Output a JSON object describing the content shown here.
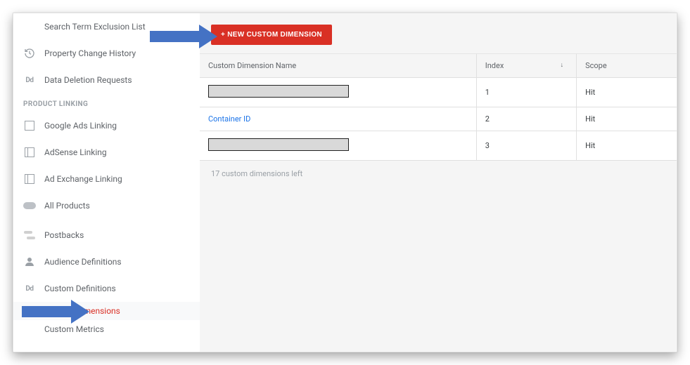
{
  "sidebar": {
    "items_top": [
      {
        "label": "Search Term Exclusion List",
        "icon": "blank"
      },
      {
        "label": "Property Change History",
        "icon": "history"
      },
      {
        "label": "Data Deletion Requests",
        "icon": "dd"
      }
    ],
    "section_label": "PRODUCT LINKING",
    "items_linking": [
      {
        "label": "Google Ads Linking",
        "icon": "square"
      },
      {
        "label": "AdSense Linking",
        "icon": "square-split"
      },
      {
        "label": "Ad Exchange Linking",
        "icon": "square-split"
      },
      {
        "label": "All Products",
        "icon": "pill"
      }
    ],
    "items_bottom": [
      {
        "label": "Postbacks",
        "icon": "arrows"
      },
      {
        "label": "Audience Definitions",
        "icon": "person"
      },
      {
        "label": "Custom Definitions",
        "icon": "dd"
      }
    ],
    "subitems": [
      {
        "label": "Custom Dimensions",
        "active": true
      },
      {
        "label": "Custom Metrics",
        "active": false
      }
    ]
  },
  "toolbar": {
    "new_button": "+ NEW CUSTOM DIMENSION"
  },
  "table": {
    "headers": {
      "name": "Custom Dimension Name",
      "index": "Index",
      "scope": "Scope"
    },
    "sort_indicator": "↓",
    "rows": [
      {
        "name_redacted": true,
        "name": "",
        "index": "1",
        "scope": "Hit"
      },
      {
        "name_redacted": false,
        "name": "Container ID",
        "index": "2",
        "scope": "Hit"
      },
      {
        "name_redacted": true,
        "name": "",
        "index": "3",
        "scope": "Hit"
      }
    ]
  },
  "footer": {
    "remaining": "17 custom dimensions left"
  },
  "arrows": {
    "color": "#4472c4"
  }
}
